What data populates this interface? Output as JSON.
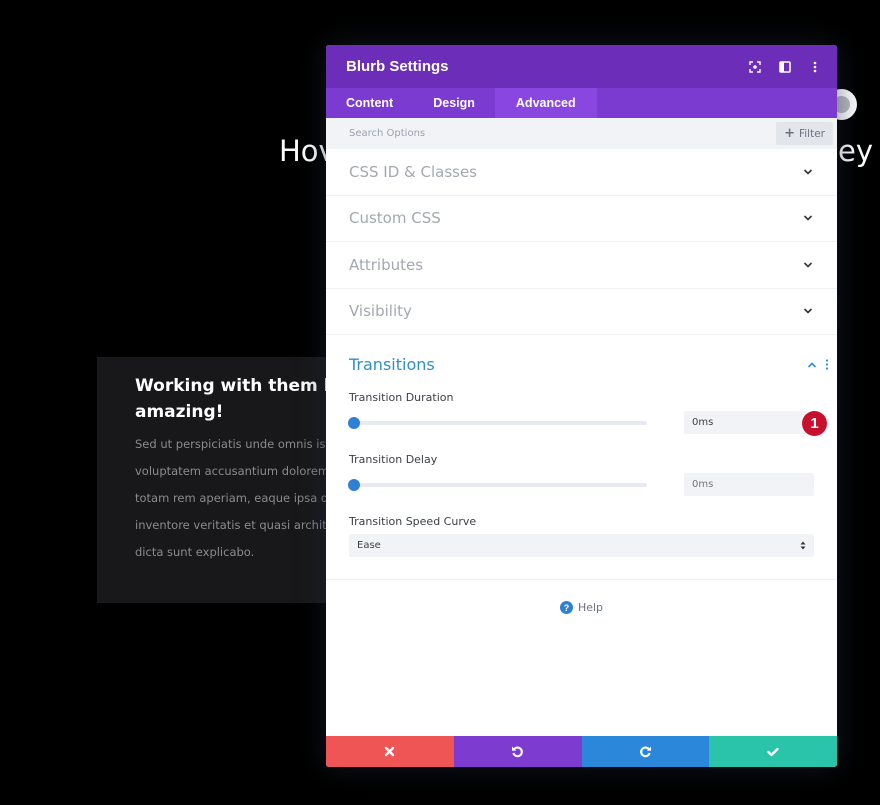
{
  "background": {
    "heading_left": "Hov",
    "heading_right": "ey",
    "testimonial": {
      "title_lines": [
        "Working with them ha",
        "amazing!"
      ],
      "body_lines": [
        "Sed ut perspiciatis unde omnis iste nat",
        "voluptatem accusantium doloremque",
        "totam rem aperiam, eaque ipsa quae a",
        "inventore veritatis et quasi architecto b",
        "dicta sunt explicabo."
      ]
    }
  },
  "modal": {
    "title": "Blurb Settings",
    "header_icons": [
      "focus-icon",
      "split-view-icon",
      "more-options-icon"
    ],
    "tabs": [
      {
        "label": "Content",
        "active": false
      },
      {
        "label": "Design",
        "active": false
      },
      {
        "label": "Advanced",
        "active": true
      }
    ],
    "search": {
      "placeholder": "Search Options",
      "value": ""
    },
    "filter_label": "Filter",
    "sections": [
      {
        "title": "CSS ID & Classes",
        "expanded": false
      },
      {
        "title": "Custom CSS",
        "expanded": false
      },
      {
        "title": "Attributes",
        "expanded": false
      },
      {
        "title": "Visibility",
        "expanded": false
      }
    ],
    "transitions": {
      "title": "Transitions",
      "expanded": true,
      "duration": {
        "label": "Transition Duration",
        "value": "0ms",
        "slider_fraction": 0
      },
      "delay": {
        "label": "Transition Delay",
        "value": "",
        "placeholder": "0ms",
        "slider_fraction": 0
      },
      "speed_curve": {
        "label": "Transition Speed Curve",
        "selected": "Ease"
      },
      "annotation_badge": "1"
    },
    "help_label": "Help",
    "footer": {
      "buttons": [
        {
          "name": "discard",
          "icon": "close-icon",
          "color": "#ef5555"
        },
        {
          "name": "undo",
          "icon": "undo-icon",
          "color": "#7e3bd0"
        },
        {
          "name": "redo",
          "icon": "redo-icon",
          "color": "#2b87da"
        },
        {
          "name": "save",
          "icon": "check-icon",
          "color": "#29c4a9"
        }
      ]
    },
    "colors": {
      "header": "#6c2eb9",
      "tabs": "#7b3ad0",
      "active_tab": "#8a46e0",
      "accent_blue": "#2e8fc9",
      "badge_red": "#c8102e"
    }
  }
}
